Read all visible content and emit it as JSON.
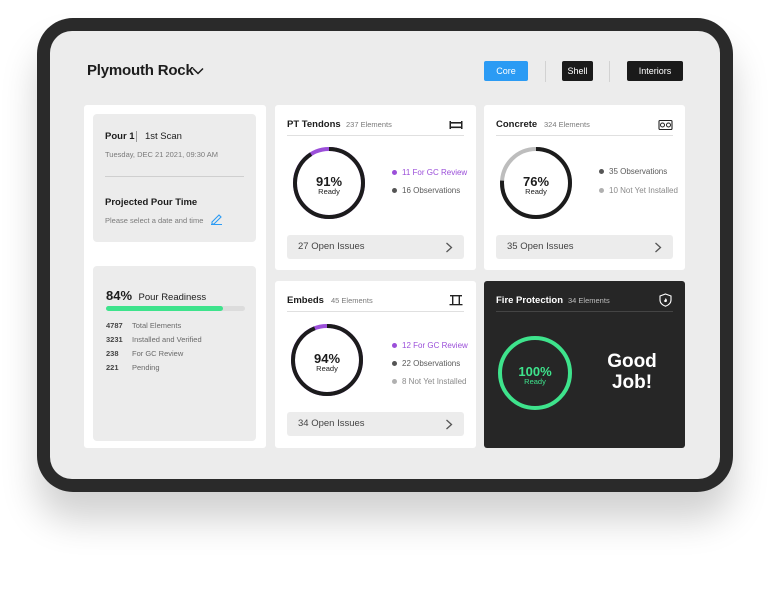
{
  "header": {
    "project_title": "Plymouth Rock",
    "tabs": [
      {
        "label": "Core",
        "active": true
      },
      {
        "label": "Shell",
        "active": false
      },
      {
        "label": "Interiors",
        "active": false
      }
    ]
  },
  "scan_card": {
    "pour": "Pour 1",
    "scan": "1st Scan",
    "datetime": "Tuesday, DEC 21 2021, 09:30 AM",
    "projected_title": "Projected Pour Time",
    "projected_hint": "Please select a date and time",
    "edit_icon": "pencil-icon"
  },
  "readiness_card": {
    "percent": "84%",
    "label": "Pour Readiness",
    "progress": 0.84,
    "stats": [
      {
        "value": "4787",
        "label": "Total Elements"
      },
      {
        "value": "3231",
        "label": "Installed and Verified"
      },
      {
        "value": "238",
        "label": "For GC Review"
      },
      {
        "value": "221",
        "label": "Pending"
      }
    ]
  },
  "cards": {
    "pt_tendons": {
      "title": "PT Tendons",
      "count": "237 Elements",
      "icon": "tendon-icon",
      "percent": "91%",
      "ready": "Ready",
      "progress": 0.91,
      "legend": [
        {
          "text": "11 For GC Review",
          "color": "#9b4fd9"
        },
        {
          "text": "16 Observations",
          "color": "#555555"
        }
      ],
      "issues": "27 Open Issues"
    },
    "concrete": {
      "title": "Concrete",
      "count": "324 Elements",
      "icon": "concrete-icon",
      "percent": "76%",
      "ready": "Ready",
      "progress": 0.76,
      "legend": [
        {
          "text": "35 Observations",
          "color": "#555555"
        },
        {
          "text": "10 Not Yet Installed",
          "color": "#b0b0b0"
        }
      ],
      "issues": "35 Open Issues"
    },
    "embeds": {
      "title": "Embeds",
      "count": "45 Elements",
      "icon": "embed-icon",
      "percent": "94%",
      "ready": "Ready",
      "progress": 0.94,
      "legend": [
        {
          "text": "12 For GC Review",
          "color": "#9b4fd9"
        },
        {
          "text": "22 Observations",
          "color": "#555555"
        },
        {
          "text": "8 Not Yet Installed",
          "color": "#b0b0b0"
        }
      ],
      "issues": "34 Open Issues"
    },
    "fire_protection": {
      "title": "Fire Protection",
      "count": "34 Elements",
      "icon": "fire-shield-icon",
      "percent": "100%",
      "ready": "Ready",
      "progress": 1.0,
      "message_line1": "Good",
      "message_line2": "Job!"
    }
  },
  "colors": {
    "accent_blue": "#2b9bf4",
    "ring_dark": "#1c1c1c",
    "ring_purple": "#9b4fd9",
    "ring_gray": "#bdbdbd",
    "success_green": "#3ee38c"
  }
}
